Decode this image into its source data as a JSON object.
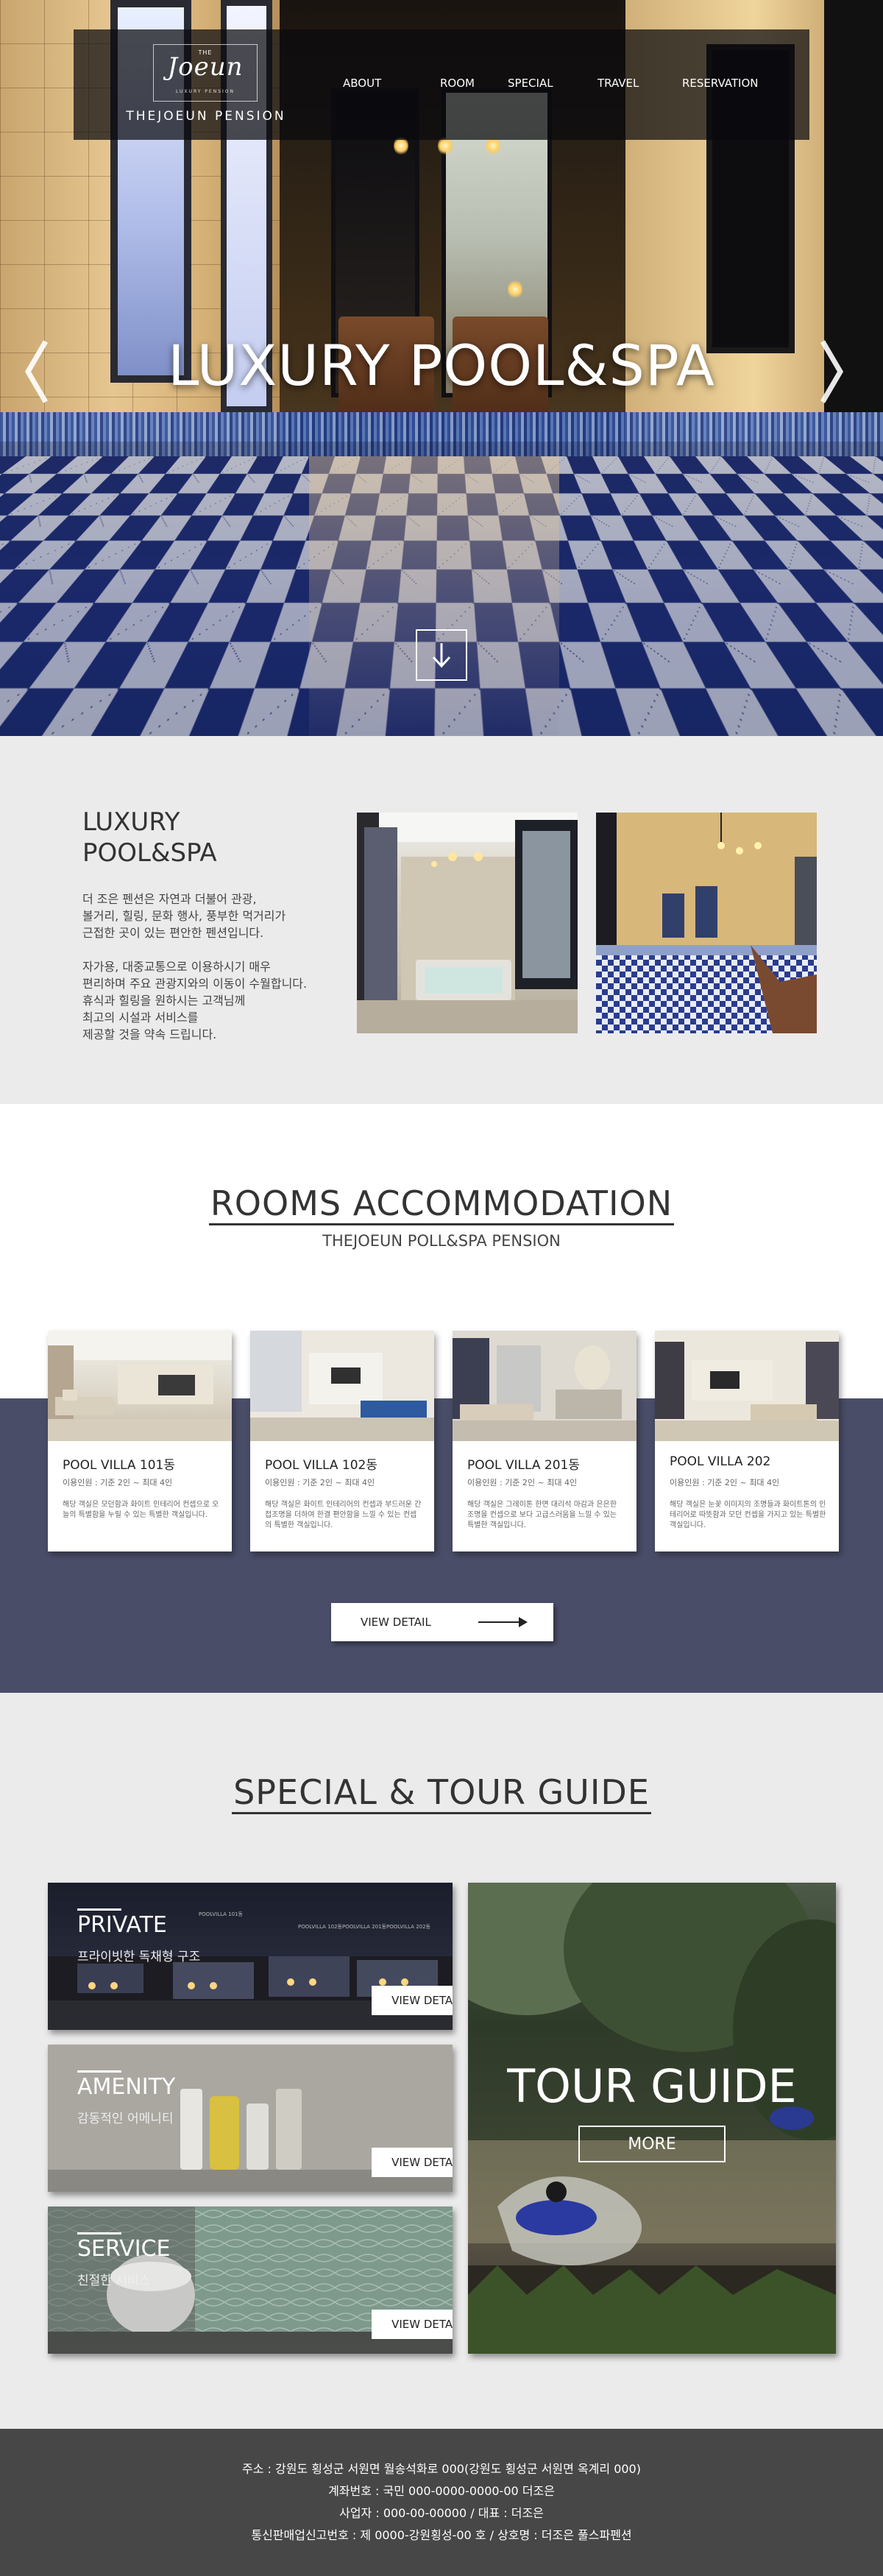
{
  "nav": {
    "logo_the": "THE",
    "logo_script": "Joeun",
    "logo_sub": "LUXURY PENSION",
    "brand": "THEJOEUN PENSION",
    "menu": [
      "ABOUT",
      "ROOM",
      "SPECIAL",
      "TRAVEL",
      "RESERVATION"
    ]
  },
  "hero": {
    "title": "LUXURY POOL&SPA",
    "prev_icon": "chevron-left-icon",
    "next_icon": "chevron-right-icon",
    "scroll_icon": "arrow-down-icon"
  },
  "intro": {
    "title_line1": "LUXURY",
    "title_line2": "POOL&SPA",
    "para1": [
      "더 조은 펜션은 자연과 더불어 관광,",
      "볼거리, 힐링, 문화 행사, 풍부한 먹거리가",
      "근접한 곳이 있는 편안한 펜션입니다."
    ],
    "para2": [
      "자가용, 대중교통으로 이용하시기 매우",
      "편리하며 주요 관광지와의 이동이 수월합니다.",
      "휴식과 힐링을 원하시는 고객님께",
      "최고의 시설과 서비스를",
      "제공할 것을 약속 드립니다."
    ]
  },
  "rooms": {
    "title": "ROOMS ACCOMMODATION",
    "subtitle": "THEJOEUN POLL&SPA PENSION",
    "cards": [
      {
        "name": "POOL VILLA 101동",
        "capacity": "이용인원 : 기준 2인 ~ 최대 4인",
        "text": "해당 객실은 모던함과 화이트 인테리어 컨셉으로 오늘의 특별함을 누릴 수 있는 특별한 객실입니다."
      },
      {
        "name": "POOL VILLA 102동",
        "capacity": "이용인원 : 기준 2인 ~ 최대 4인",
        "text": "해당 객실은 화이트 인테리어의 컨셉과 부드러운 간접조명을 더하여 한결 편안함을 느낄 수 있는 컨셉의 특별한 객실입니다."
      },
      {
        "name": "POOL VILLA 201동",
        "capacity": "이용인원 : 기준 2인 ~ 최대 4인",
        "text": "해당 객실은 그레이톤 한면 대리석 마감과 은은한 조명을 컨셉으로 보다 고급스러움을 느낄 수 있는 특별한 객실입니다."
      },
      {
        "name": "POOL VILLA 202",
        "capacity": "이용인원 : 기준 2인 ~ 최대 4인",
        "text": "해당 객실은 눈꽃 이미지의 조명들과 화이트톤의 인테리어로 따뜻함과 모던 컨셉을 가지고 있는 특별한 객실입니다."
      }
    ],
    "view_detail": "VIEW DETAIL"
  },
  "special": {
    "title": "SPECIAL & TOUR GUIDE",
    "tiles": [
      {
        "title": "PRIVATE",
        "subtitle": "프라이빗한 독채형 구조",
        "button": "VIEW DETAIL"
      },
      {
        "title": "AMENITY",
        "subtitle": "감동적인 어메니티",
        "button": "VIEW DETAIL"
      },
      {
        "title": "SERVICE",
        "subtitle": "친절한 서비스",
        "button": "VIEW DETAIL"
      }
    ],
    "private_labels": [
      "POOLVILLA 101동",
      "POOLVILLA 102동",
      "POOLVILLA 201동",
      "POOLVILLA 202동"
    ],
    "tour_title": "TOUR GUIDE",
    "tour_button": "MORE"
  },
  "footer": {
    "lines": [
      "주소 : 강원도 횡성군 서원면 월송석화로 000(강원도 횡성군 서원면 옥계리 000)",
      "계좌번호 : 국민 000-0000-0000-00 더조은",
      "사업자 : 000-00-00000 / 대표 : 더조은",
      "통신판매업신고번호 : 제 0000-강원횡성-00 호 / 상호명 : 더조은 풀스파펜션"
    ]
  }
}
